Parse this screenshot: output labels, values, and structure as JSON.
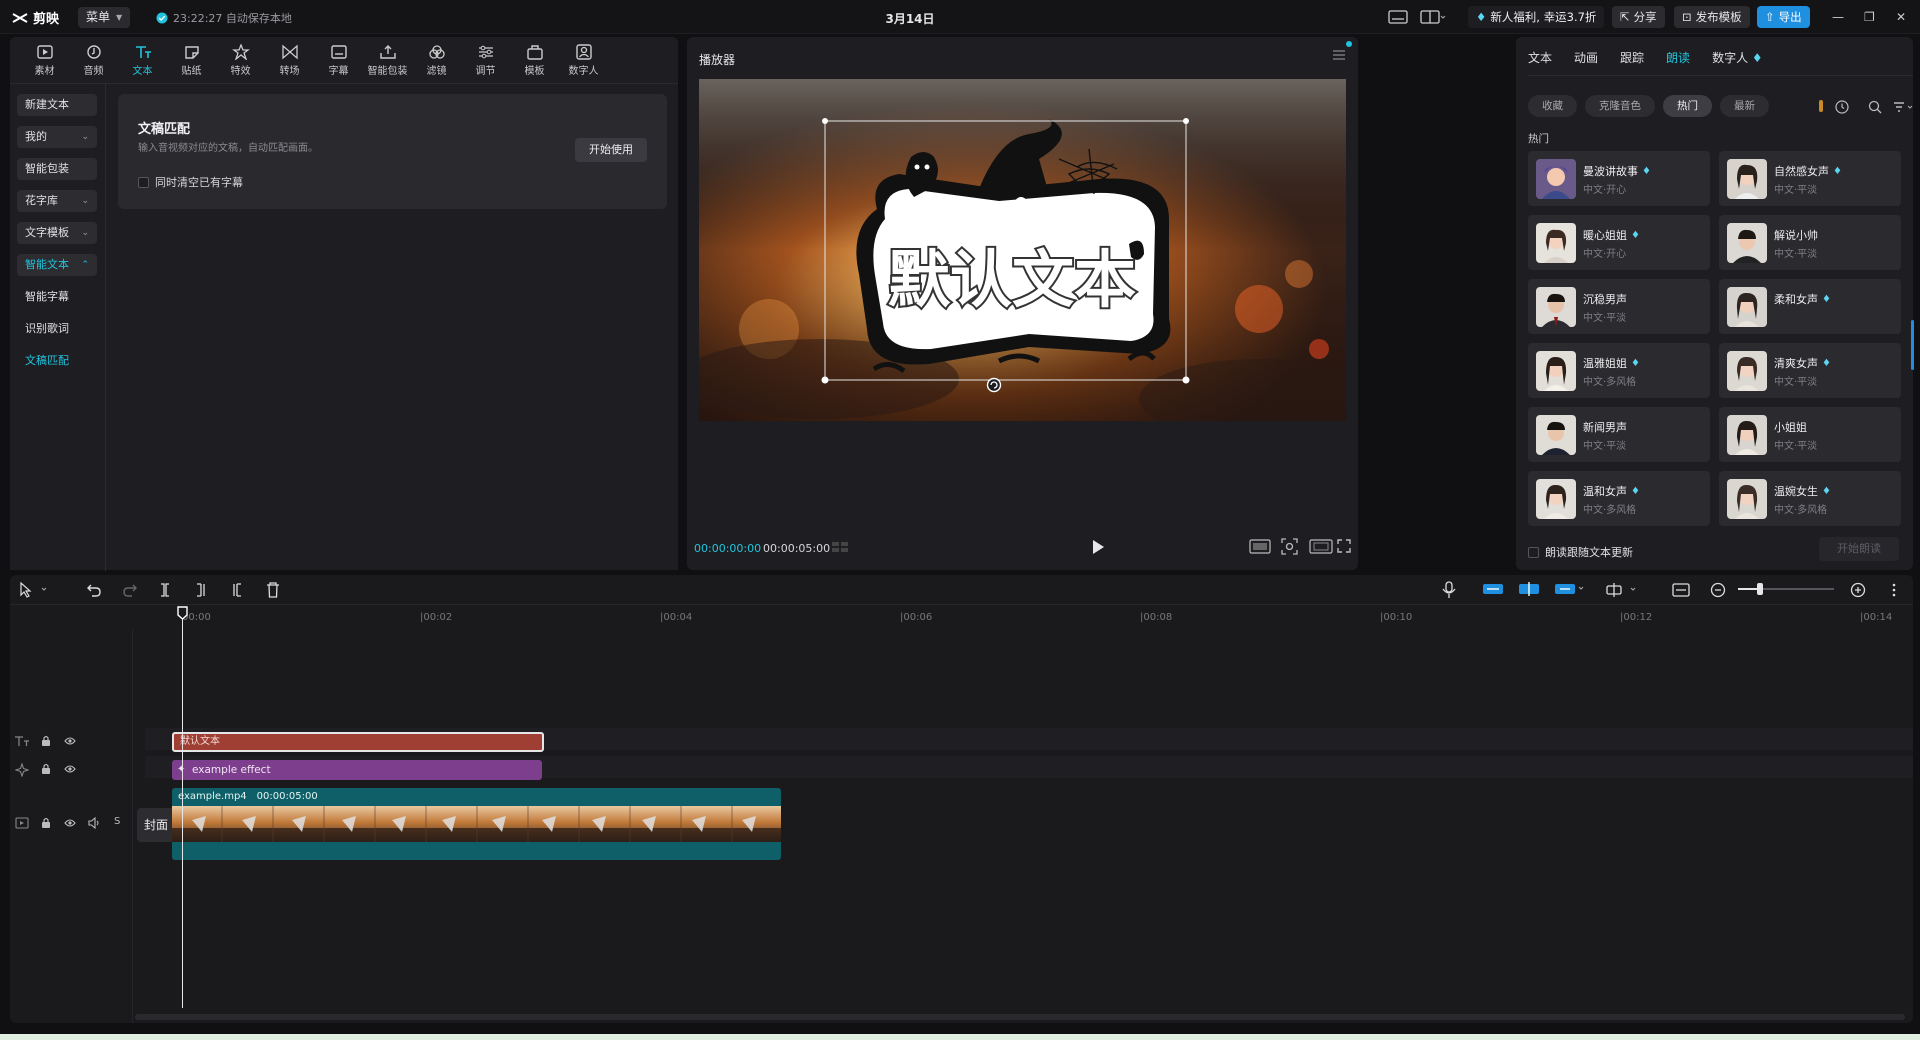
{
  "app": {
    "name": "剪映",
    "menu_label": "菜单",
    "autosave": "23:22:27 自动保存本地",
    "doc_title": "3月14日",
    "promo": "新人福利, 幸运3.7折",
    "share": "分享",
    "publish_template": "发布模板",
    "export": "导出"
  },
  "toolbar": {
    "tools": [
      {
        "label": "素材",
        "icon": "media-icon"
      },
      {
        "label": "音频",
        "icon": "audio-icon"
      },
      {
        "label": "文本",
        "icon": "text-icon"
      },
      {
        "label": "贴纸",
        "icon": "sticker-icon"
      },
      {
        "label": "特效",
        "icon": "effects-icon"
      },
      {
        "label": "转场",
        "icon": "transition-icon"
      },
      {
        "label": "字幕",
        "icon": "subtitle-icon"
      },
      {
        "label": "智能包装",
        "icon": "smart-pack-icon"
      },
      {
        "label": "滤镜",
        "icon": "filter-icon"
      },
      {
        "label": "调节",
        "icon": "adjust-icon"
      },
      {
        "label": "模板",
        "icon": "template-icon"
      },
      {
        "label": "数字人",
        "icon": "digital-human-icon"
      }
    ],
    "active": "文本"
  },
  "leftnav": {
    "items": [
      "新建文本",
      "我的",
      "智能包装",
      "花字库",
      "文字模板",
      "智能文本",
      "智能字幕",
      "识别歌词",
      "文稿匹配"
    ]
  },
  "doc_match_card": {
    "title": "文稿匹配",
    "desc": "输入音视频对应的文稿，自动匹配画面。",
    "button": "开始使用",
    "checkbox_label": "同时清空已有字幕"
  },
  "player": {
    "title": "播放器",
    "overlay_text": "默认文本",
    "time_current": "00:00:00:00",
    "time_total": "00:00:05:00"
  },
  "rightpanel": {
    "tabs": [
      "文本",
      "动画",
      "跟踪",
      "朗读",
      "数字人"
    ],
    "active_tab": "朗读",
    "filters": [
      "收藏",
      "克隆音色",
      "热门",
      "最新"
    ],
    "active_filter": "热门",
    "section": "热门",
    "voices": [
      {
        "name": "曼波讲故事",
        "style": "中文·开心",
        "vip": true
      },
      {
        "name": "自然感女声",
        "style": "中文·平淡",
        "vip": true
      },
      {
        "name": "暖心姐姐",
        "style": "中文·开心",
        "vip": true
      },
      {
        "name": "解说小帅",
        "style": "中文·平淡",
        "vip": false
      },
      {
        "name": "沉稳男声",
        "style": "中文·平淡",
        "vip": false
      },
      {
        "name": "柔和女声",
        "style": "",
        "vip": true
      },
      {
        "name": "温雅姐姐",
        "style": "中文·多风格",
        "vip": true
      },
      {
        "name": "清爽女声",
        "style": "中文·平淡",
        "vip": true
      },
      {
        "name": "新闻男声",
        "style": "中文·平淡",
        "vip": false
      },
      {
        "name": "小姐姐",
        "style": "中文·平淡",
        "vip": false
      },
      {
        "name": "温和女声",
        "style": "中文·多风格",
        "vip": true
      },
      {
        "name": "温婉女生",
        "style": "中文·多风格",
        "vip": true
      }
    ],
    "follow_label": "朗读跟随文本更新",
    "start_label": "开始朗读"
  },
  "timeline": {
    "ruler": [
      "00:00",
      "|00:02",
      "|00:04",
      "|00:06",
      "|00:08",
      "|00:10",
      "|00:12",
      "|00:14"
    ],
    "text_clip": "默认文本",
    "effect_clip": "example effect",
    "video_clip_name": "example.mp4",
    "video_clip_duration": "00:00:05:00",
    "cover_label": "封面"
  },
  "colors": {
    "accent": "#21c4dd",
    "text_clip": "#9f3f33",
    "effect_clip": "#7d3f8d",
    "video_clip": "#0e5f68"
  }
}
